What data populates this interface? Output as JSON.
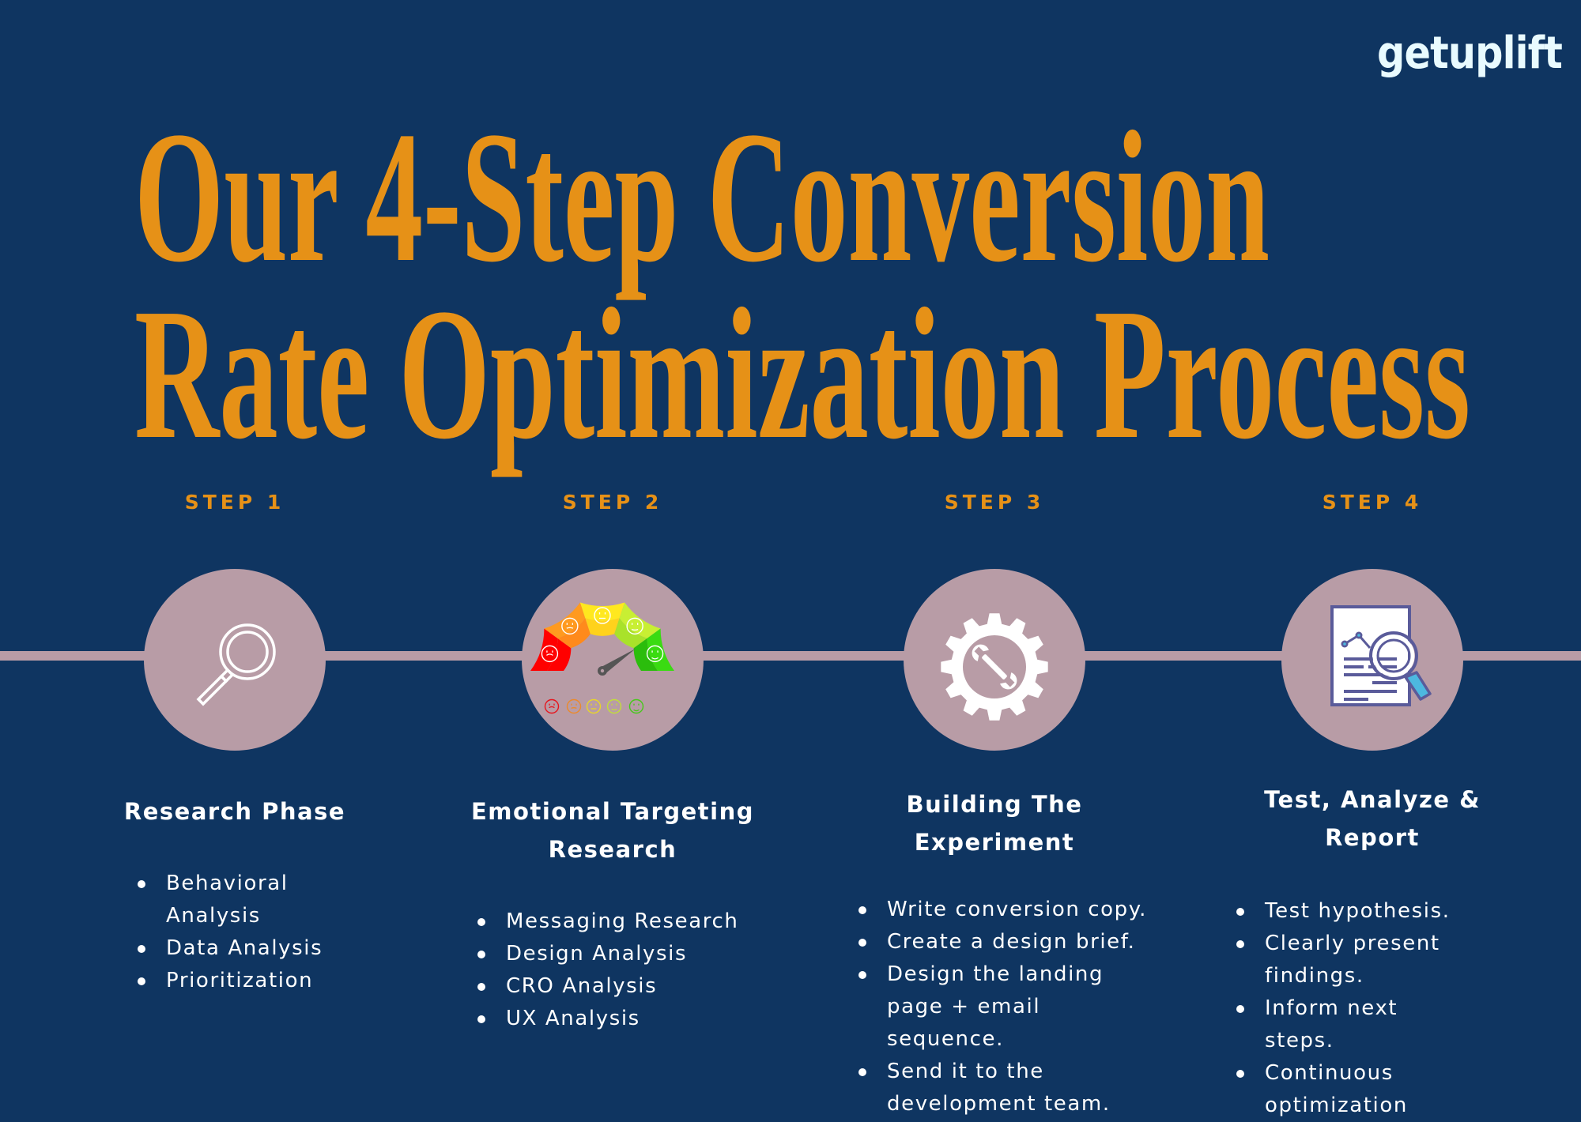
{
  "brand": {
    "logo_text": "getuplift",
    "colors": {
      "background": "#0f3561",
      "accent": "#e69117",
      "circle": "#b89ca6",
      "text": "#ffffff",
      "logo": "#e9fbff"
    }
  },
  "title": {
    "line1": "Our 4-Step Conversion",
    "line2": "Rate Optimization Process"
  },
  "steps": [
    {
      "label": "STEP 1",
      "icon": "magnifying-glass-icon",
      "heading_lines": [
        "Research Phase"
      ],
      "items": [
        "Behavioral Analysis",
        "Data Analysis",
        "Prioritization"
      ]
    },
    {
      "label": "STEP 2",
      "icon": "emotion-gauge-icon",
      "heading_lines": [
        "Emotional Targeting",
        "Research"
      ],
      "items": [
        "Messaging Research",
        "Design Analysis",
        "CRO Analysis",
        "UX Analysis"
      ]
    },
    {
      "label": "STEP 3",
      "icon": "gear-wrench-icon",
      "heading_lines": [
        "Building The",
        "Experiment"
      ],
      "items": [
        "Write conversion copy.",
        "Create a design brief.",
        "Design the landing page + email sequence.",
        "Send it to the development team."
      ]
    },
    {
      "label": "STEP 4",
      "icon": "report-magnifier-icon",
      "heading_lines": [
        "Test, Analyze &",
        "Report"
      ],
      "items": [
        "Test hypothesis.",
        "Clearly present findings.",
        "Inform next steps.",
        "Continuous optimization"
      ]
    }
  ]
}
